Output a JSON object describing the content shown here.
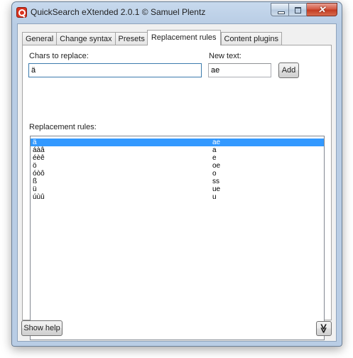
{
  "window": {
    "title": "QuickSearch eXtended 2.0.1 © Samuel Plentz"
  },
  "caption": {
    "close_glyph": "✕"
  },
  "tabs": [
    {
      "label": "General"
    },
    {
      "label": "Change syntax"
    },
    {
      "label": "Presets"
    },
    {
      "label": "Replacement rules"
    },
    {
      "label": "Content plugins"
    }
  ],
  "form": {
    "chars_label": "Chars to replace:",
    "chars_value": "ä",
    "new_text_label": "New text:",
    "new_text_value": "ae",
    "add_label": "Add",
    "rules_label": "Replacement rules:"
  },
  "rules": [
    {
      "from": "ä",
      "to": "ae"
    },
    {
      "from": "áàâ",
      "to": "a"
    },
    {
      "from": "éèê",
      "to": "e"
    },
    {
      "from": "ö",
      "to": "oe"
    },
    {
      "from": "óòô",
      "to": "o"
    },
    {
      "from": "ß",
      "to": "ss"
    },
    {
      "from": "ü",
      "to": "ue"
    },
    {
      "from": "úùû",
      "to": "u"
    }
  ],
  "footer": {
    "show_help_label": "Show help",
    "expand_glyph": "≫"
  }
}
